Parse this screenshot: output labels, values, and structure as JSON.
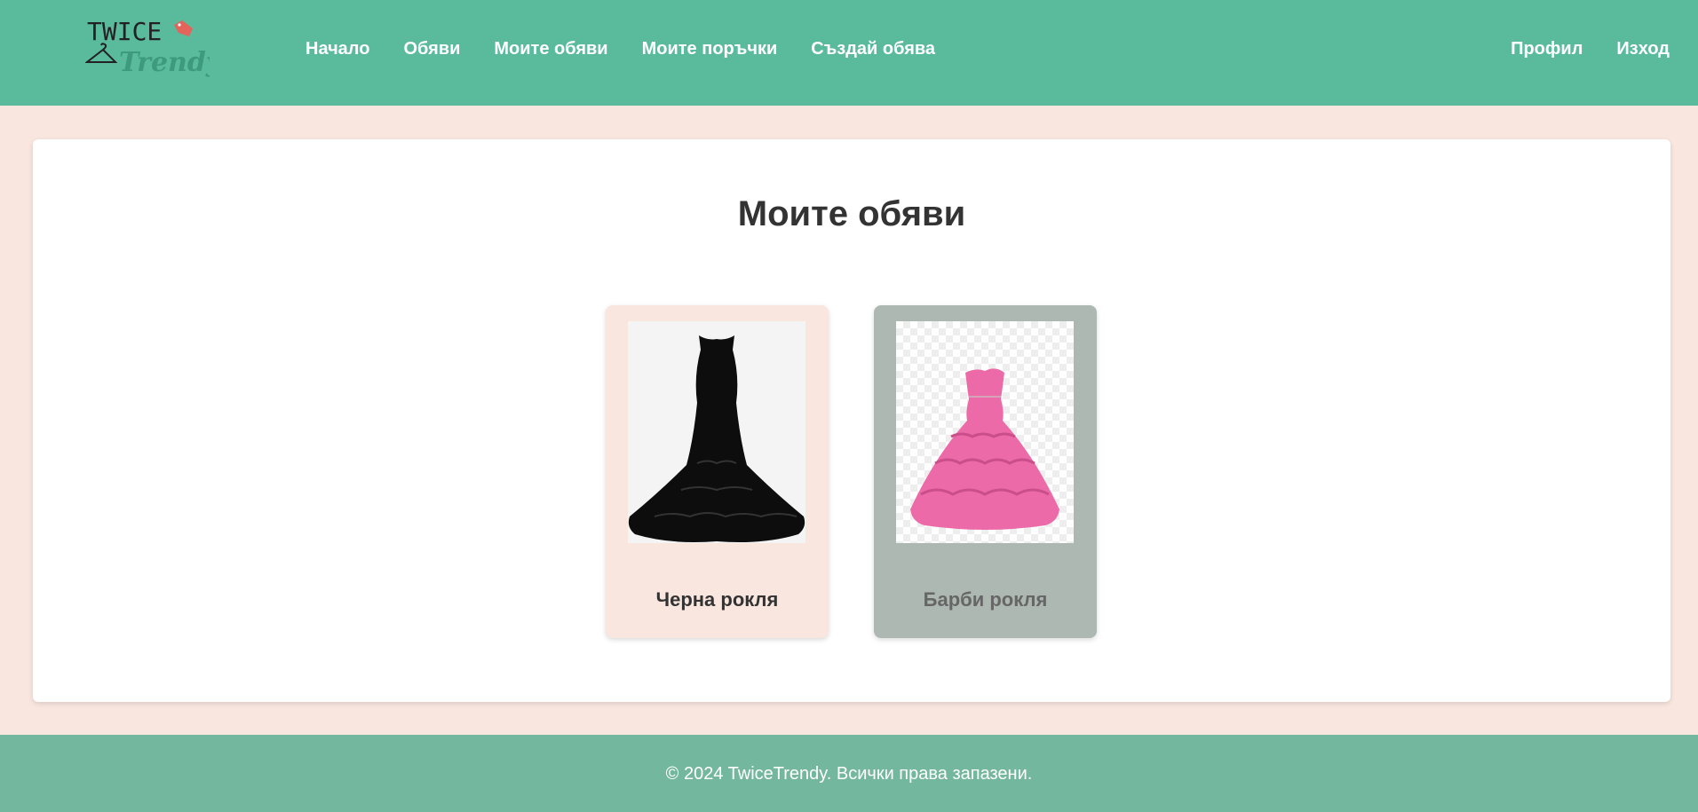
{
  "header": {
    "logo": {
      "word1": "TWICE",
      "word2": "Trendy"
    },
    "nav": [
      "Начало",
      "Обяви",
      "Моите обяви",
      "Моите поръчки",
      "Създай обява"
    ],
    "nav_right": [
      "Профил",
      "Изход"
    ]
  },
  "main": {
    "title": "Моите обяви",
    "listings": [
      {
        "name": "Черна рокля"
      },
      {
        "name": "Барби рокля"
      }
    ]
  },
  "footer": {
    "copyright": "© 2024 TwiceTrendy. Всички права запазени."
  },
  "colors": {
    "header_bg": "#5aba9c",
    "page_bg": "#f8e6df",
    "footer_bg": "#74b79f",
    "card_black_dress_bg": "#f8e6df",
    "card_barbie_dress_bg": "#adb8b3"
  }
}
